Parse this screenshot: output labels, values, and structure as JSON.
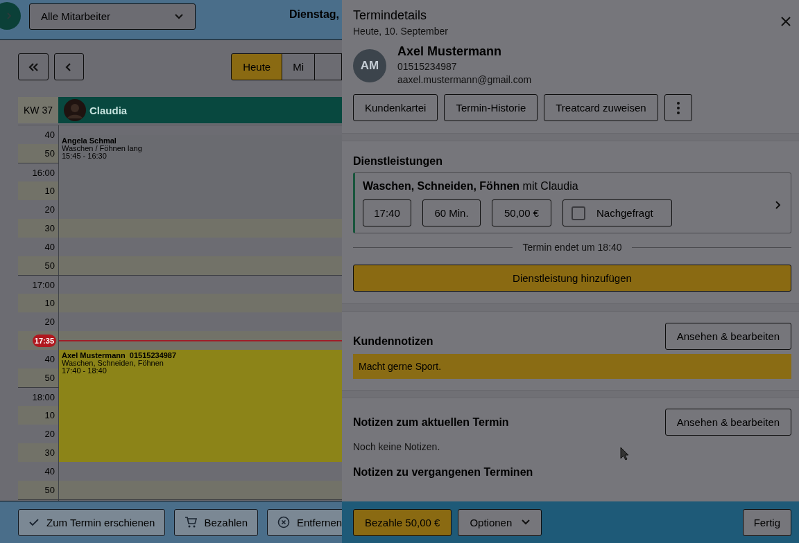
{
  "header": {
    "employee_filter": "Alle Mitarbeiter",
    "date_title": "Dienstag,"
  },
  "toolbar": {
    "view_tabs": [
      {
        "label": "Heute",
        "selected": true
      },
      {
        "label": "Mi",
        "selected": false
      }
    ]
  },
  "calendar": {
    "week": "KW 37",
    "staff": "Claudia",
    "rows": [
      {
        "kind": "time",
        "label": "40"
      },
      {
        "kind": "time",
        "label": "50"
      },
      {
        "kind": "time",
        "label": "16:00"
      },
      {
        "kind": "time",
        "label": "10"
      },
      {
        "kind": "time",
        "label": "20"
      },
      {
        "kind": "time",
        "label": "30"
      },
      {
        "kind": "time",
        "label": "40"
      },
      {
        "kind": "time",
        "label": "50"
      },
      {
        "kind": "time",
        "label": "17:00"
      },
      {
        "kind": "time",
        "label": "10"
      },
      {
        "kind": "time",
        "label": "20"
      },
      {
        "kind": "now",
        "label": "17:35"
      },
      {
        "kind": "time",
        "label": "40"
      },
      {
        "kind": "time",
        "label": "50"
      },
      {
        "kind": "time",
        "label": "18:00"
      },
      {
        "kind": "time",
        "label": "10"
      },
      {
        "kind": "time",
        "label": "20"
      },
      {
        "kind": "time",
        "label": "30"
      },
      {
        "kind": "time",
        "label": "40"
      },
      {
        "kind": "time",
        "label": "50"
      }
    ],
    "appointments": [
      {
        "client": "Angela Schmal",
        "service": "Waschen / Föhnen lang",
        "time": "15:45 - 16:30",
        "color": "#6a6b70"
      },
      {
        "client": "Axel Mustermann  01515234987",
        "service": "Waschen, Schneiden, Föhnen",
        "time": "17:40 - 18:40",
        "color": "#8c8418"
      }
    ]
  },
  "actions": [
    "Zum Termin erschienen",
    "Bezahlen",
    "Entfernen"
  ],
  "details": {
    "title": "Termindetails",
    "subtitle": "Heute, 10. September",
    "client": {
      "initials": "AM",
      "name": "Axel Mustermann",
      "phone": "01515234987",
      "email": "aaxel.mustermann@gmail.com"
    },
    "client_actions": [
      "Kundenkartei",
      "Termin-Historie",
      "Treatcard zuweisen"
    ],
    "services": {
      "heading": "Dienstleistungen",
      "items": [
        {
          "title": "**Waschen, Schneiden, Föhnen** mit Claudia",
          "start": "17:40",
          "duration": "60 Min.",
          "price": "50,00 €",
          "requested": {
            "label": "Nachgefragt",
            "checked": false
          }
        }
      ],
      "end_note": "Termin endet um 18:40",
      "add_button": "Dienstleistung hinzufügen"
    },
    "customer_notes": {
      "heading": "Kundennotizen",
      "button": "Ansehen & bearbeiten",
      "note": "Macht gerne Sport."
    },
    "appointment_notes": {
      "heading": "Notizen zum aktuellen Termin",
      "button": "Ansehen & bearbeiten",
      "empty": "Noch keine Notizen."
    },
    "past_notes": {
      "heading": "Notizen zu vergangenen Terminen"
    },
    "footer": {
      "pay_button": "Bezahle 50,00 €",
      "options_button": "Optionen",
      "done_button": "Fertig"
    }
  }
}
